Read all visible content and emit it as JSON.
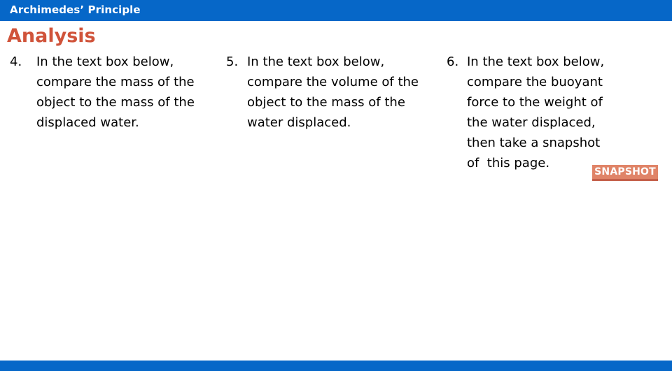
{
  "colors": {
    "header_bar": "#0667C8",
    "footer_bar": "#0667C8",
    "heading_accent": "#D0533A",
    "badge_background": "#E08468",
    "badge_underline": "#C4604A",
    "badge_text": "#FFFFFF",
    "body_text": "#000000",
    "page_background": "#FFFFFF"
  },
  "header": {
    "title": "Archimedes’ Principle"
  },
  "heading": {
    "text": "Analysis"
  },
  "columns": [
    {
      "number": "4.",
      "lines": [
        "In the text box below,",
        "compare the mass of the",
        "object to the mass of the",
        "displaced water."
      ]
    },
    {
      "number": "5.",
      "lines": [
        "In the text box below,",
        "compare the volume of the",
        "object to the mass of the",
        "water displaced."
      ]
    },
    {
      "number": "6.",
      "lines": [
        "In the text box below,",
        "compare the buoyant",
        "force to the weight of",
        "the water displaced,",
        "then take a snapshot",
        "of  this page."
      ]
    }
  ],
  "badge": {
    "label": "SNAPSHOT"
  }
}
